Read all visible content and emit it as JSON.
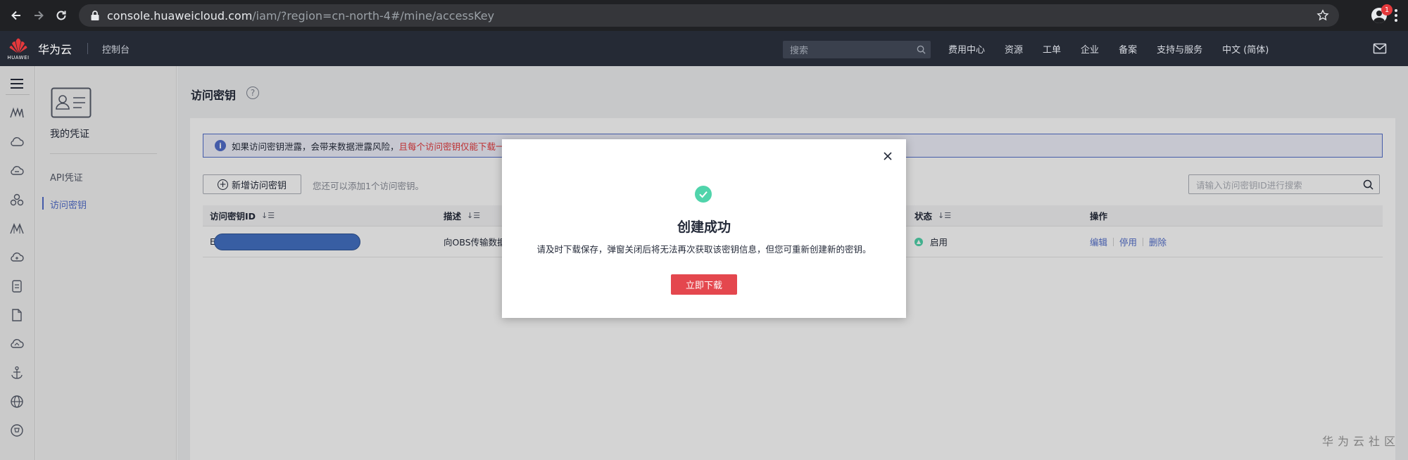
{
  "browser": {
    "url_host": "console.huaweicloud.com",
    "url_path": "/iam/?region=cn-north-4#/mine/accessKey"
  },
  "header": {
    "logo_text": "HUAWEI",
    "brand": "华为云",
    "console": "控制台",
    "search_placeholder": "搜索",
    "menu": [
      "费用中心",
      "资源",
      "工单",
      "企业",
      "备案",
      "支持与服务",
      "中文 (简体)"
    ],
    "mail_badge": "1"
  },
  "rail": {
    "icons": [
      "menu-icon",
      "brand-mark-icon",
      "cloud-icon",
      "cloud-server-icon",
      "cluster-icon",
      "mountain-icon",
      "cloud-plus-icon",
      "document-icon",
      "file-icon",
      "cloud-refresh-icon",
      "anchor-icon",
      "globe-icon",
      "cart-icon"
    ]
  },
  "submenu": {
    "title": "我的凭证",
    "items": [
      {
        "label": "API凭证",
        "active": false
      },
      {
        "label": "访问密钥",
        "active": true
      }
    ]
  },
  "page": {
    "title": "访问密钥",
    "notice": "如果访问密钥泄露，会带来数据泄露风险，",
    "notice_warning": "且每个访问密钥仅能下载一",
    "add_button": "新增访问密钥",
    "quota_text": "您还可以添加1个访问密钥。",
    "search_placeholder": "请输入访问密钥ID进行搜索",
    "table": {
      "headers": [
        "访问密钥ID",
        "描述",
        "状态",
        "操作"
      ],
      "rows": [
        {
          "id_prefix": "E",
          "description": "向OBS传输数据",
          "status": "启用",
          "actions": [
            "编辑",
            "停用",
            "删除"
          ]
        }
      ]
    }
  },
  "modal": {
    "title": "创建成功",
    "message": "请及时下载保存，弹窗关闭后将无法再次获取该密钥信息，但您可重新创建新的密钥。",
    "download_button": "立即下载"
  },
  "watermark": "华为云社区",
  "colors": {
    "accent": "#526ecc",
    "danger": "#e4474e",
    "success": "#50d4ab",
    "header_bg": "#252a35"
  }
}
